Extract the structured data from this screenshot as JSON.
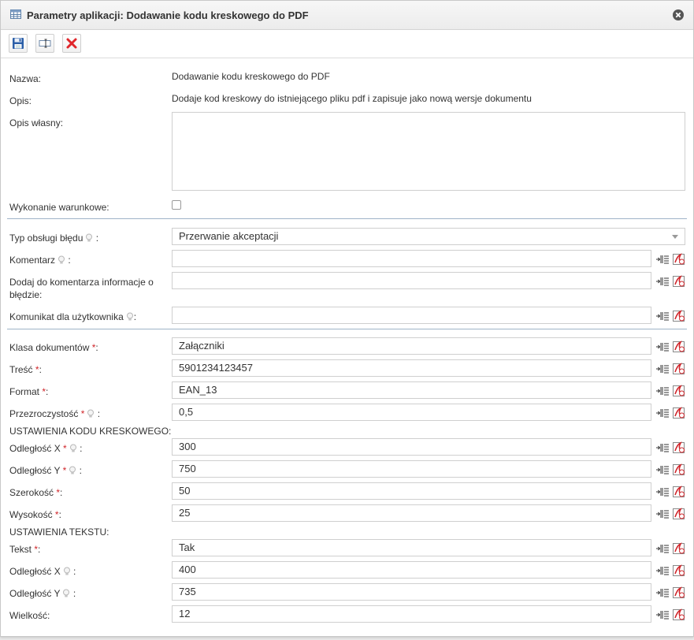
{
  "window": {
    "title": "Parametry aplikacji: Dodawanie kodu kreskowego do PDF"
  },
  "icons": {
    "title": "table-icon",
    "close": "close-circle-icon",
    "save": "floppy-disk-icon",
    "rename": "textbox-icon",
    "delete": "red-x-icon",
    "hint": "lightbulb-icon",
    "insert_variable": "insert-list-icon",
    "clear_value": "pdf-eraser-icon"
  },
  "colors": {
    "required": "#d0262b",
    "separator": "#9fb3c8",
    "delete": "#e0262b"
  },
  "info": {
    "name_label": "Nazwa:",
    "name_value": "Dodawanie kodu kreskowego do PDF",
    "desc_label": "Opis:",
    "desc_value": "Dodaje kod kreskowy do istniejącego pliku pdf i zapisuje jako nową wersje dokumentu",
    "own_desc_label": "Opis własny:",
    "own_desc_value": "",
    "conditional_label": "Wykonanie warunkowe:",
    "conditional_checked": false
  },
  "error": {
    "type_label": "Typ obsługi błędu",
    "type_value": "Przerwanie akceptacji",
    "comment_label": "Komentarz",
    "comment_value": "",
    "add_info_label_1": "Dodaj do komentarza informacje o",
    "add_info_label_2": "błędzie:",
    "add_info_value": "",
    "message_label": "Komunikat dla użytkownika",
    "message_value": ""
  },
  "params": {
    "doc_class_label": "Klasa dokumentów",
    "doc_class_value": "Załączniki",
    "content_label": "Treść",
    "content_value": "5901234123457",
    "format_label": "Format",
    "format_value": "EAN_13",
    "transparency_label": "Przezroczystość",
    "transparency_value": "0,5"
  },
  "barcode": {
    "heading": "USTAWIENIA KODU KRESKOWEGO:",
    "dist_x_label": "Odległość X",
    "dist_x_value": "300",
    "dist_y_label": "Odległość Y",
    "dist_y_value": "750",
    "width_label": "Szerokość",
    "width_value": "50",
    "height_label": "Wysokość",
    "height_value": "25"
  },
  "text": {
    "heading": "USTAWIENIA TEKSTU:",
    "text_label": "Tekst",
    "text_value": "Tak",
    "dist_x_label": "Odległość X",
    "dist_x_value": "400",
    "dist_y_label": "Odległość Y",
    "dist_y_value": "735",
    "size_label": "Wielkość:",
    "size_value": "12"
  },
  "marks": {
    "required": "*",
    "colon": ":"
  }
}
